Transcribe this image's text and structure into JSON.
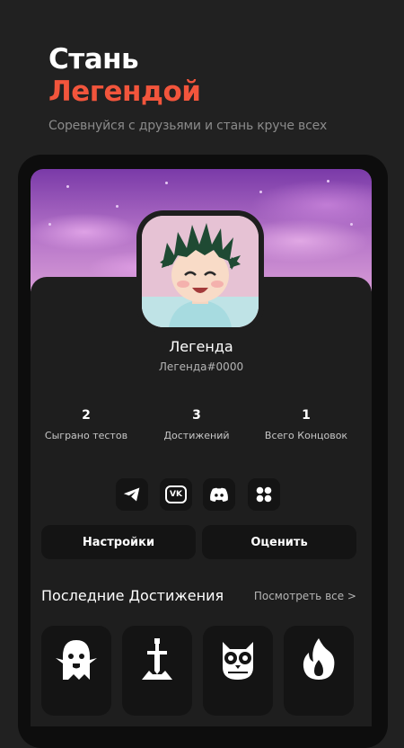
{
  "promo": {
    "title_line1": "Стань",
    "title_line2": "Легендой",
    "subtitle": "Соревнуйся с друзьями и стань круче всех",
    "accent_color": "#f2553c"
  },
  "profile": {
    "name": "Легенда",
    "tag": "Легенда#0000",
    "avatar_icon": "anime-boy-avatar"
  },
  "stats": [
    {
      "value": "2",
      "label": "Сыграно тестов"
    },
    {
      "value": "3",
      "label": "Достижений"
    },
    {
      "value": "1",
      "label": "Всего Концовок"
    }
  ],
  "socials": [
    {
      "icon": "telegram-icon"
    },
    {
      "icon": "vk-icon",
      "text": "VK"
    },
    {
      "icon": "discord-icon"
    },
    {
      "icon": "apps-icon"
    }
  ],
  "actions": {
    "settings_label": "Настройки",
    "rate_label": "Оценить"
  },
  "achievements": {
    "title": "Последние Достижения",
    "view_all": "Посмотреть все >",
    "items": [
      {
        "icon": "ghost-icon"
      },
      {
        "icon": "sword-icon"
      },
      {
        "icon": "owl-icon"
      },
      {
        "icon": "fire-icon"
      }
    ]
  }
}
